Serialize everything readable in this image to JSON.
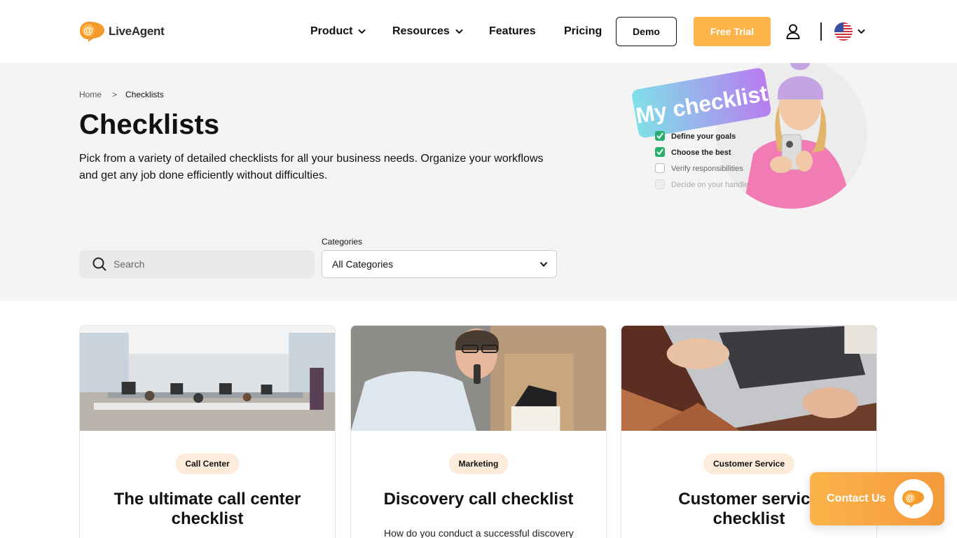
{
  "brand": {
    "name": "LiveAgent",
    "accent": "#fcb34a"
  },
  "nav": {
    "items": [
      {
        "label": "Product",
        "has_dropdown": true
      },
      {
        "label": "Resources",
        "has_dropdown": true
      },
      {
        "label": "Features",
        "has_dropdown": false
      },
      {
        "label": "Pricing",
        "has_dropdown": false
      }
    ],
    "demo_label": "Demo",
    "trial_label": "Free Trial",
    "user_icon": "user-icon",
    "language_icon": "us-flag-icon"
  },
  "breadcrumb": {
    "home": "Home",
    "separator": ">",
    "current": "Checklists"
  },
  "hero": {
    "title": "Checklists",
    "description": "Pick from a variety of detailed checklists for all your business needs. Organize your workflows and get any job done efficiently without difficulties.",
    "illustration": {
      "banner": "My checklist",
      "items": [
        {
          "label": "Define your goals",
          "checked": true
        },
        {
          "label": "Choose the best",
          "checked": true
        },
        {
          "label": "Verify responsibilities",
          "checked": false
        },
        {
          "label": "Decide on your handle",
          "checked": false
        }
      ]
    }
  },
  "filters": {
    "search_placeholder": "Search",
    "categories_label": "Categories",
    "categories_selected": "All Categories"
  },
  "cards": [
    {
      "tag": "Call Center",
      "title": "The ultimate call center checklist",
      "text": ""
    },
    {
      "tag": "Marketing",
      "title": "Discovery call checklist",
      "text": "How do you conduct a successful discovery"
    },
    {
      "tag": "Customer Service",
      "title": "Customer service checklist",
      "text": ""
    }
  ],
  "contact": {
    "label": "Contact Us"
  }
}
